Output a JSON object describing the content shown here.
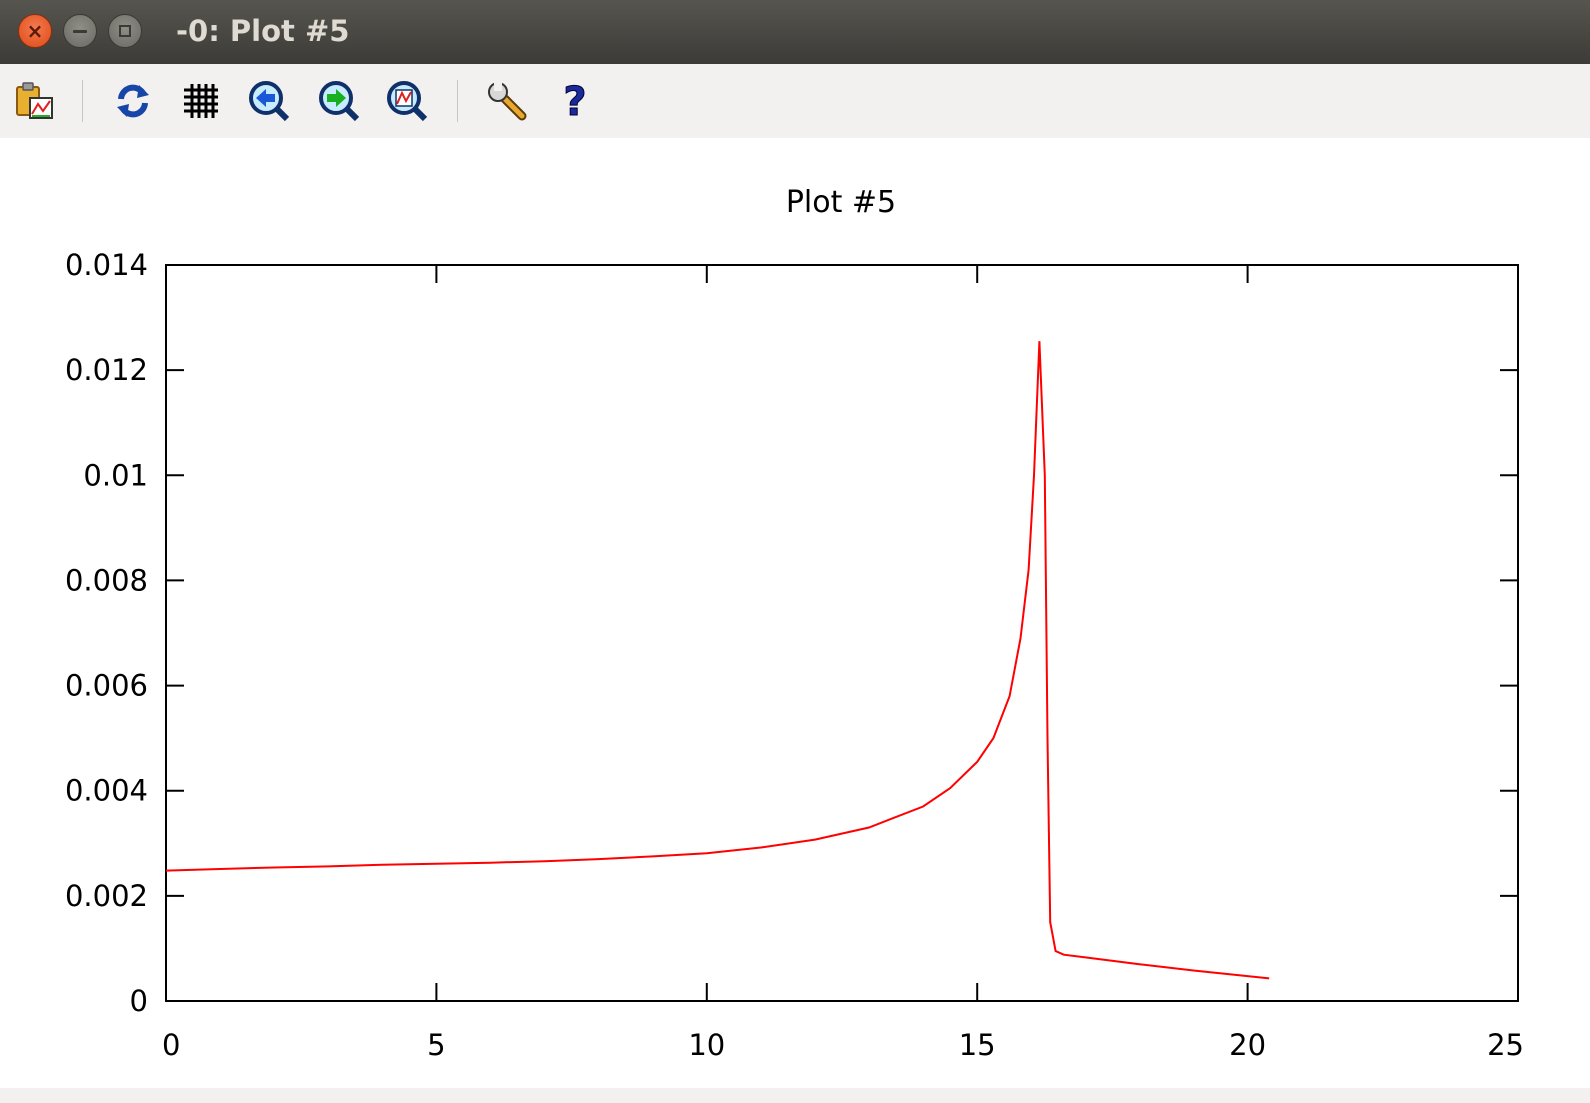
{
  "window": {
    "title": "-0: Plot #5",
    "close_glyph": "×"
  },
  "toolbar": {
    "buttons": [
      {
        "name": "copy-to-clipboard-button",
        "icon": "clipboard-plot-icon"
      },
      {
        "name": "replot-button",
        "icon": "refresh-icon"
      },
      {
        "name": "toggle-grid-button",
        "icon": "grid-icon"
      },
      {
        "name": "previous-zoom-button",
        "icon": "zoom-back-icon"
      },
      {
        "name": "next-zoom-button",
        "icon": "zoom-forward-icon"
      },
      {
        "name": "autoscale-button",
        "icon": "zoom-autoscale-icon"
      },
      {
        "name": "preferences-button",
        "icon": "wrench-icon"
      },
      {
        "name": "help-button",
        "icon": "help-icon"
      }
    ]
  },
  "colors": {
    "series": "#ff0000",
    "axis": "#000000"
  },
  "chart_data": {
    "type": "line",
    "title": "Plot #5",
    "xlabel": "",
    "ylabel": "",
    "xlim": [
      0,
      25
    ],
    "ylim": [
      0,
      0.014
    ],
    "xticks": [
      0,
      5,
      10,
      15,
      20,
      25
    ],
    "xtick_labels": [
      "0",
      "5",
      "10",
      "15",
      "20",
      "25"
    ],
    "yticks": [
      0,
      0.002,
      0.004,
      0.006,
      0.008,
      0.01,
      0.012,
      0.014
    ],
    "ytick_labels": [
      "0",
      "0.002",
      "0.004",
      "0.006",
      "0.008",
      "0.01",
      "0.012",
      "0.014"
    ],
    "grid": false,
    "legend": "none",
    "series": [
      {
        "color": "#ff0000",
        "points": [
          [
            0,
            0.00248
          ],
          [
            1,
            0.00251
          ],
          [
            2,
            0.00254
          ],
          [
            3,
            0.00256
          ],
          [
            4,
            0.00259
          ],
          [
            5,
            0.00261
          ],
          [
            6,
            0.00263
          ],
          [
            7,
            0.00266
          ],
          [
            8,
            0.0027
          ],
          [
            9,
            0.00275
          ],
          [
            10,
            0.00281
          ],
          [
            11,
            0.00292
          ],
          [
            12,
            0.00307
          ],
          [
            13,
            0.0033
          ],
          [
            14,
            0.0037
          ],
          [
            14.5,
            0.00405
          ],
          [
            15,
            0.00455
          ],
          [
            15.3,
            0.005
          ],
          [
            15.6,
            0.0058
          ],
          [
            15.8,
            0.0069
          ],
          [
            15.95,
            0.0082
          ],
          [
            16.05,
            0.01
          ],
          [
            16.15,
            0.01255
          ],
          [
            16.25,
            0.01
          ],
          [
            16.3,
            0.005
          ],
          [
            16.35,
            0.0015
          ],
          [
            16.45,
            0.00095
          ],
          [
            16.6,
            0.00088
          ],
          [
            17,
            0.00083
          ],
          [
            18,
            0.0007
          ],
          [
            19,
            0.00058
          ],
          [
            20.4,
            0.00043
          ]
        ]
      }
    ]
  }
}
